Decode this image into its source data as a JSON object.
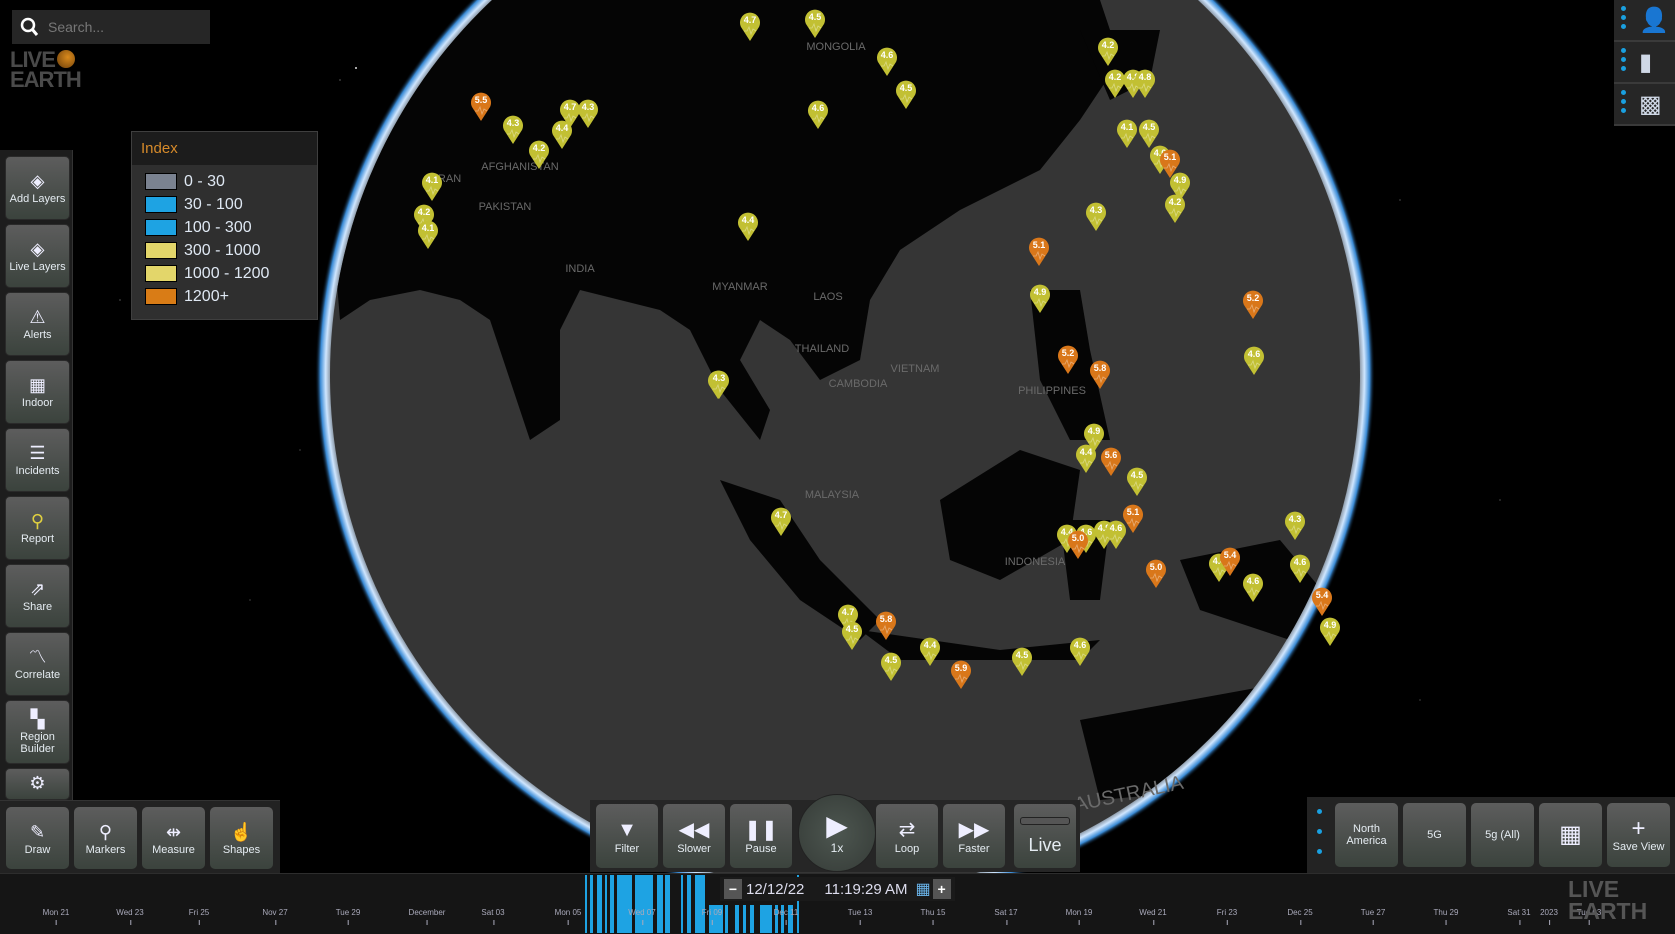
{
  "search": {
    "placeholder": "Search..."
  },
  "logo": {
    "line1": "LIVE",
    "line2": "EARTH"
  },
  "legend": {
    "title": "Index",
    "items": [
      {
        "label": "0 - 30",
        "color": "#7a8290"
      },
      {
        "label": "30 - 100",
        "color": "#1ea3e3"
      },
      {
        "label": "100 - 300",
        "color": "#1ea3e3"
      },
      {
        "label": "300 - 1000",
        "color": "#e3d66a"
      },
      {
        "label": "1000 - 1200",
        "color": "#e3d66a"
      },
      {
        "label": "1200+",
        "color": "#d97c16"
      }
    ]
  },
  "sidebar": {
    "items": [
      {
        "label": "Add Layers",
        "icon": "layers-add-icon",
        "glyph": "◈"
      },
      {
        "label": "Live Layers",
        "icon": "layers-live-icon",
        "glyph": "◈"
      },
      {
        "label": "Alerts",
        "icon": "alert-triangle-icon",
        "glyph": "⚠"
      },
      {
        "label": "Indoor",
        "icon": "building-icon",
        "glyph": "▦"
      },
      {
        "label": "Incidents",
        "icon": "clipboard-icon",
        "glyph": "☰"
      },
      {
        "label": "Report",
        "icon": "report-pin-icon",
        "glyph": "⚲"
      },
      {
        "label": "Share",
        "icon": "share-icon",
        "glyph": "⇗"
      },
      {
        "label": "Correlate",
        "icon": "chart-line-icon",
        "glyph": "〽"
      },
      {
        "label": "Region Builder",
        "icon": "region-builder-icon",
        "glyph": "▚"
      },
      {
        "label": "",
        "icon": "gear-icon",
        "glyph": "⚙"
      }
    ]
  },
  "bottom_tools": [
    {
      "label": "Draw",
      "icon": "pencil-icon",
      "glyph": "✎"
    },
    {
      "label": "Markers",
      "icon": "map-pin-icon",
      "glyph": "⚲"
    },
    {
      "label": "Measure",
      "icon": "ruler-icon",
      "glyph": "⇹"
    },
    {
      "label": "Shapes",
      "icon": "shapes-icon",
      "glyph": "☝"
    }
  ],
  "playback": {
    "buttons": [
      {
        "label": "Filter",
        "icon": "filter-icon",
        "glyph": "▼"
      },
      {
        "label": "Slower",
        "icon": "rewind-icon",
        "glyph": "◀◀"
      },
      {
        "label": "Pause",
        "icon": "pause-icon",
        "glyph": "❚❚"
      },
      {
        "label": "Loop",
        "icon": "loop-icon",
        "glyph": "⇄"
      },
      {
        "label": "Faster",
        "icon": "fast-forward-icon",
        "glyph": "▶▶"
      }
    ],
    "play": {
      "glyph": "▶",
      "speed": "1x"
    },
    "live_label": "Live"
  },
  "right_tools": [
    {
      "label": "North America",
      "icon": "",
      "glyph": ""
    },
    {
      "label": "5G",
      "icon": "",
      "glyph": ""
    },
    {
      "label": "5g (All)",
      "icon": "",
      "glyph": ""
    },
    {
      "label": "",
      "icon": "grid-icon",
      "glyph": "▦"
    },
    {
      "label": "Save View",
      "icon": "plus-icon",
      "glyph": "+"
    }
  ],
  "top_right": [
    {
      "icon": "user-profile-icon",
      "glyph": "👤"
    },
    {
      "icon": "bar-chart-icon",
      "glyph": "▮"
    },
    {
      "icon": "map-region-icon",
      "glyph": "▩"
    }
  ],
  "timeline": {
    "date": "12/12/22",
    "time": "11:19:29 AM",
    "minus": "−",
    "plus": "+",
    "ticks": [
      "Mon 21",
      "Wed 23",
      "Fri 25",
      "Nov 27",
      "Tue 29",
      "December",
      "Sat 03",
      "Mon 05",
      "Wed 07",
      "Fri 09",
      "Dec 11",
      "Tue 13",
      "Thu 15",
      "Sat 17",
      "Mon 19",
      "Wed 21",
      "Fri 23",
      "Dec 25",
      "Tue 27",
      "Thu 29",
      "Sat 31",
      "2023",
      "Tue 03"
    ]
  },
  "map": {
    "labels": [
      "MONGOLIA",
      "AFGHANISTAN",
      "PAKISTAN",
      "IRAN",
      "INDIA",
      "MYANMAR",
      "LAOS",
      "THAILAND",
      "CAMBODIA",
      "VIETNAM",
      "MALAYSIA",
      "INDONESIA",
      "PHILIPPINES",
      "AUSTRALIA"
    ],
    "earthquakes": [
      {
        "mag": "5.5",
        "sev": "high"
      },
      {
        "mag": "4.3",
        "sev": "low"
      },
      {
        "mag": "4.2",
        "sev": "low"
      },
      {
        "mag": "4.4",
        "sev": "low"
      },
      {
        "mag": "4.7",
        "sev": "low"
      },
      {
        "mag": "4.3",
        "sev": "low"
      },
      {
        "mag": "4.7",
        "sev": "low"
      },
      {
        "mag": "4.5",
        "sev": "low"
      },
      {
        "mag": "4.6",
        "sev": "low"
      },
      {
        "mag": "4.5",
        "sev": "low"
      },
      {
        "mag": "4.6",
        "sev": "low"
      },
      {
        "mag": "4.1",
        "sev": "low"
      },
      {
        "mag": "4.2",
        "sev": "low"
      },
      {
        "mag": "4.1",
        "sev": "low"
      },
      {
        "mag": "4.4",
        "sev": "low"
      },
      {
        "mag": "4.3",
        "sev": "low"
      },
      {
        "mag": "4.2",
        "sev": "low"
      },
      {
        "mag": "4.2",
        "sev": "low"
      },
      {
        "mag": "4.8",
        "sev": "low"
      },
      {
        "mag": "4.8",
        "sev": "low"
      },
      {
        "mag": "4.1",
        "sev": "low"
      },
      {
        "mag": "4.5",
        "sev": "low"
      },
      {
        "mag": "4.6",
        "sev": "low"
      },
      {
        "mag": "5.1",
        "sev": "high"
      },
      {
        "mag": "4.9",
        "sev": "low"
      },
      {
        "mag": "4.2",
        "sev": "low"
      },
      {
        "mag": "4.3",
        "sev": "low"
      },
      {
        "mag": "5.1",
        "sev": "high"
      },
      {
        "mag": "4.9",
        "sev": "low"
      },
      {
        "mag": "5.2",
        "sev": "high"
      },
      {
        "mag": "4.6",
        "sev": "low"
      },
      {
        "mag": "5.2",
        "sev": "high"
      },
      {
        "mag": "5.8",
        "sev": "high"
      },
      {
        "mag": "4.9",
        "sev": "low"
      },
      {
        "mag": "4.4",
        "sev": "low"
      },
      {
        "mag": "5.6",
        "sev": "high"
      },
      {
        "mag": "4.5",
        "sev": "low"
      },
      {
        "mag": "5.1",
        "sev": "high"
      },
      {
        "mag": "4.4",
        "sev": "low"
      },
      {
        "mag": "4.6",
        "sev": "low"
      },
      {
        "mag": "5.0",
        "sev": "high"
      },
      {
        "mag": "4.9",
        "sev": "low"
      },
      {
        "mag": "4.6",
        "sev": "low"
      },
      {
        "mag": "5.0",
        "sev": "high"
      },
      {
        "mag": "4.3",
        "sev": "low"
      },
      {
        "mag": "4.4",
        "sev": "low"
      },
      {
        "mag": "5.4",
        "sev": "high"
      },
      {
        "mag": "4.6",
        "sev": "low"
      },
      {
        "mag": "4.6",
        "sev": "low"
      },
      {
        "mag": "5.4",
        "sev": "high"
      },
      {
        "mag": "4.9",
        "sev": "low"
      },
      {
        "mag": "4.3",
        "sev": "low"
      },
      {
        "mag": "4.7",
        "sev": "low"
      },
      {
        "mag": "4.7",
        "sev": "low"
      },
      {
        "mag": "4.5",
        "sev": "low"
      },
      {
        "mag": "5.8",
        "sev": "high"
      },
      {
        "mag": "4.5",
        "sev": "low"
      },
      {
        "mag": "4.4",
        "sev": "low"
      },
      {
        "mag": "5.9",
        "sev": "high"
      },
      {
        "mag": "4.5",
        "sev": "low"
      },
      {
        "mag": "4.6",
        "sev": "low"
      }
    ],
    "colors": {
      "low": "#c2c033",
      "high": "#d9771a"
    }
  }
}
